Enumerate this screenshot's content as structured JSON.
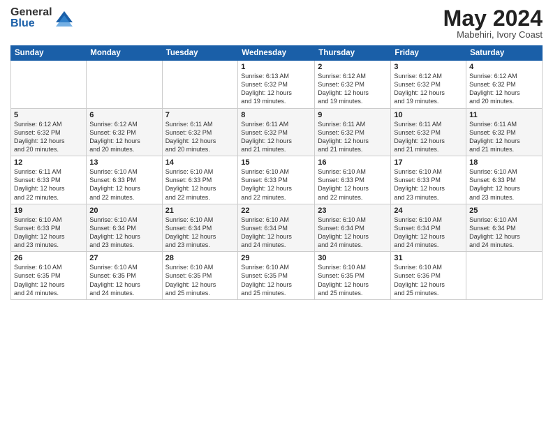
{
  "logo": {
    "general": "General",
    "blue": "Blue"
  },
  "title": "May 2024",
  "location": "Mabehiri, Ivory Coast",
  "days_of_week": [
    "Sunday",
    "Monday",
    "Tuesday",
    "Wednesday",
    "Thursday",
    "Friday",
    "Saturday"
  ],
  "weeks": [
    [
      {
        "day": "",
        "info": ""
      },
      {
        "day": "",
        "info": ""
      },
      {
        "day": "",
        "info": ""
      },
      {
        "day": "1",
        "info": "Sunrise: 6:13 AM\nSunset: 6:32 PM\nDaylight: 12 hours\nand 19 minutes."
      },
      {
        "day": "2",
        "info": "Sunrise: 6:12 AM\nSunset: 6:32 PM\nDaylight: 12 hours\nand 19 minutes."
      },
      {
        "day": "3",
        "info": "Sunrise: 6:12 AM\nSunset: 6:32 PM\nDaylight: 12 hours\nand 19 minutes."
      },
      {
        "day": "4",
        "info": "Sunrise: 6:12 AM\nSunset: 6:32 PM\nDaylight: 12 hours\nand 20 minutes."
      }
    ],
    [
      {
        "day": "5",
        "info": "Sunrise: 6:12 AM\nSunset: 6:32 PM\nDaylight: 12 hours\nand 20 minutes."
      },
      {
        "day": "6",
        "info": "Sunrise: 6:12 AM\nSunset: 6:32 PM\nDaylight: 12 hours\nand 20 minutes."
      },
      {
        "day": "7",
        "info": "Sunrise: 6:11 AM\nSunset: 6:32 PM\nDaylight: 12 hours\nand 20 minutes."
      },
      {
        "day": "8",
        "info": "Sunrise: 6:11 AM\nSunset: 6:32 PM\nDaylight: 12 hours\nand 21 minutes."
      },
      {
        "day": "9",
        "info": "Sunrise: 6:11 AM\nSunset: 6:32 PM\nDaylight: 12 hours\nand 21 minutes."
      },
      {
        "day": "10",
        "info": "Sunrise: 6:11 AM\nSunset: 6:32 PM\nDaylight: 12 hours\nand 21 minutes."
      },
      {
        "day": "11",
        "info": "Sunrise: 6:11 AM\nSunset: 6:32 PM\nDaylight: 12 hours\nand 21 minutes."
      }
    ],
    [
      {
        "day": "12",
        "info": "Sunrise: 6:11 AM\nSunset: 6:33 PM\nDaylight: 12 hours\nand 22 minutes."
      },
      {
        "day": "13",
        "info": "Sunrise: 6:10 AM\nSunset: 6:33 PM\nDaylight: 12 hours\nand 22 minutes."
      },
      {
        "day": "14",
        "info": "Sunrise: 6:10 AM\nSunset: 6:33 PM\nDaylight: 12 hours\nand 22 minutes."
      },
      {
        "day": "15",
        "info": "Sunrise: 6:10 AM\nSunset: 6:33 PM\nDaylight: 12 hours\nand 22 minutes."
      },
      {
        "day": "16",
        "info": "Sunrise: 6:10 AM\nSunset: 6:33 PM\nDaylight: 12 hours\nand 22 minutes."
      },
      {
        "day": "17",
        "info": "Sunrise: 6:10 AM\nSunset: 6:33 PM\nDaylight: 12 hours\nand 23 minutes."
      },
      {
        "day": "18",
        "info": "Sunrise: 6:10 AM\nSunset: 6:33 PM\nDaylight: 12 hours\nand 23 minutes."
      }
    ],
    [
      {
        "day": "19",
        "info": "Sunrise: 6:10 AM\nSunset: 6:33 PM\nDaylight: 12 hours\nand 23 minutes."
      },
      {
        "day": "20",
        "info": "Sunrise: 6:10 AM\nSunset: 6:34 PM\nDaylight: 12 hours\nand 23 minutes."
      },
      {
        "day": "21",
        "info": "Sunrise: 6:10 AM\nSunset: 6:34 PM\nDaylight: 12 hours\nand 23 minutes."
      },
      {
        "day": "22",
        "info": "Sunrise: 6:10 AM\nSunset: 6:34 PM\nDaylight: 12 hours\nand 24 minutes."
      },
      {
        "day": "23",
        "info": "Sunrise: 6:10 AM\nSunset: 6:34 PM\nDaylight: 12 hours\nand 24 minutes."
      },
      {
        "day": "24",
        "info": "Sunrise: 6:10 AM\nSunset: 6:34 PM\nDaylight: 12 hours\nand 24 minutes."
      },
      {
        "day": "25",
        "info": "Sunrise: 6:10 AM\nSunset: 6:34 PM\nDaylight: 12 hours\nand 24 minutes."
      }
    ],
    [
      {
        "day": "26",
        "info": "Sunrise: 6:10 AM\nSunset: 6:35 PM\nDaylight: 12 hours\nand 24 minutes."
      },
      {
        "day": "27",
        "info": "Sunrise: 6:10 AM\nSunset: 6:35 PM\nDaylight: 12 hours\nand 24 minutes."
      },
      {
        "day": "28",
        "info": "Sunrise: 6:10 AM\nSunset: 6:35 PM\nDaylight: 12 hours\nand 25 minutes."
      },
      {
        "day": "29",
        "info": "Sunrise: 6:10 AM\nSunset: 6:35 PM\nDaylight: 12 hours\nand 25 minutes."
      },
      {
        "day": "30",
        "info": "Sunrise: 6:10 AM\nSunset: 6:35 PM\nDaylight: 12 hours\nand 25 minutes."
      },
      {
        "day": "31",
        "info": "Sunrise: 6:10 AM\nSunset: 6:36 PM\nDaylight: 12 hours\nand 25 minutes."
      },
      {
        "day": "",
        "info": ""
      }
    ]
  ]
}
